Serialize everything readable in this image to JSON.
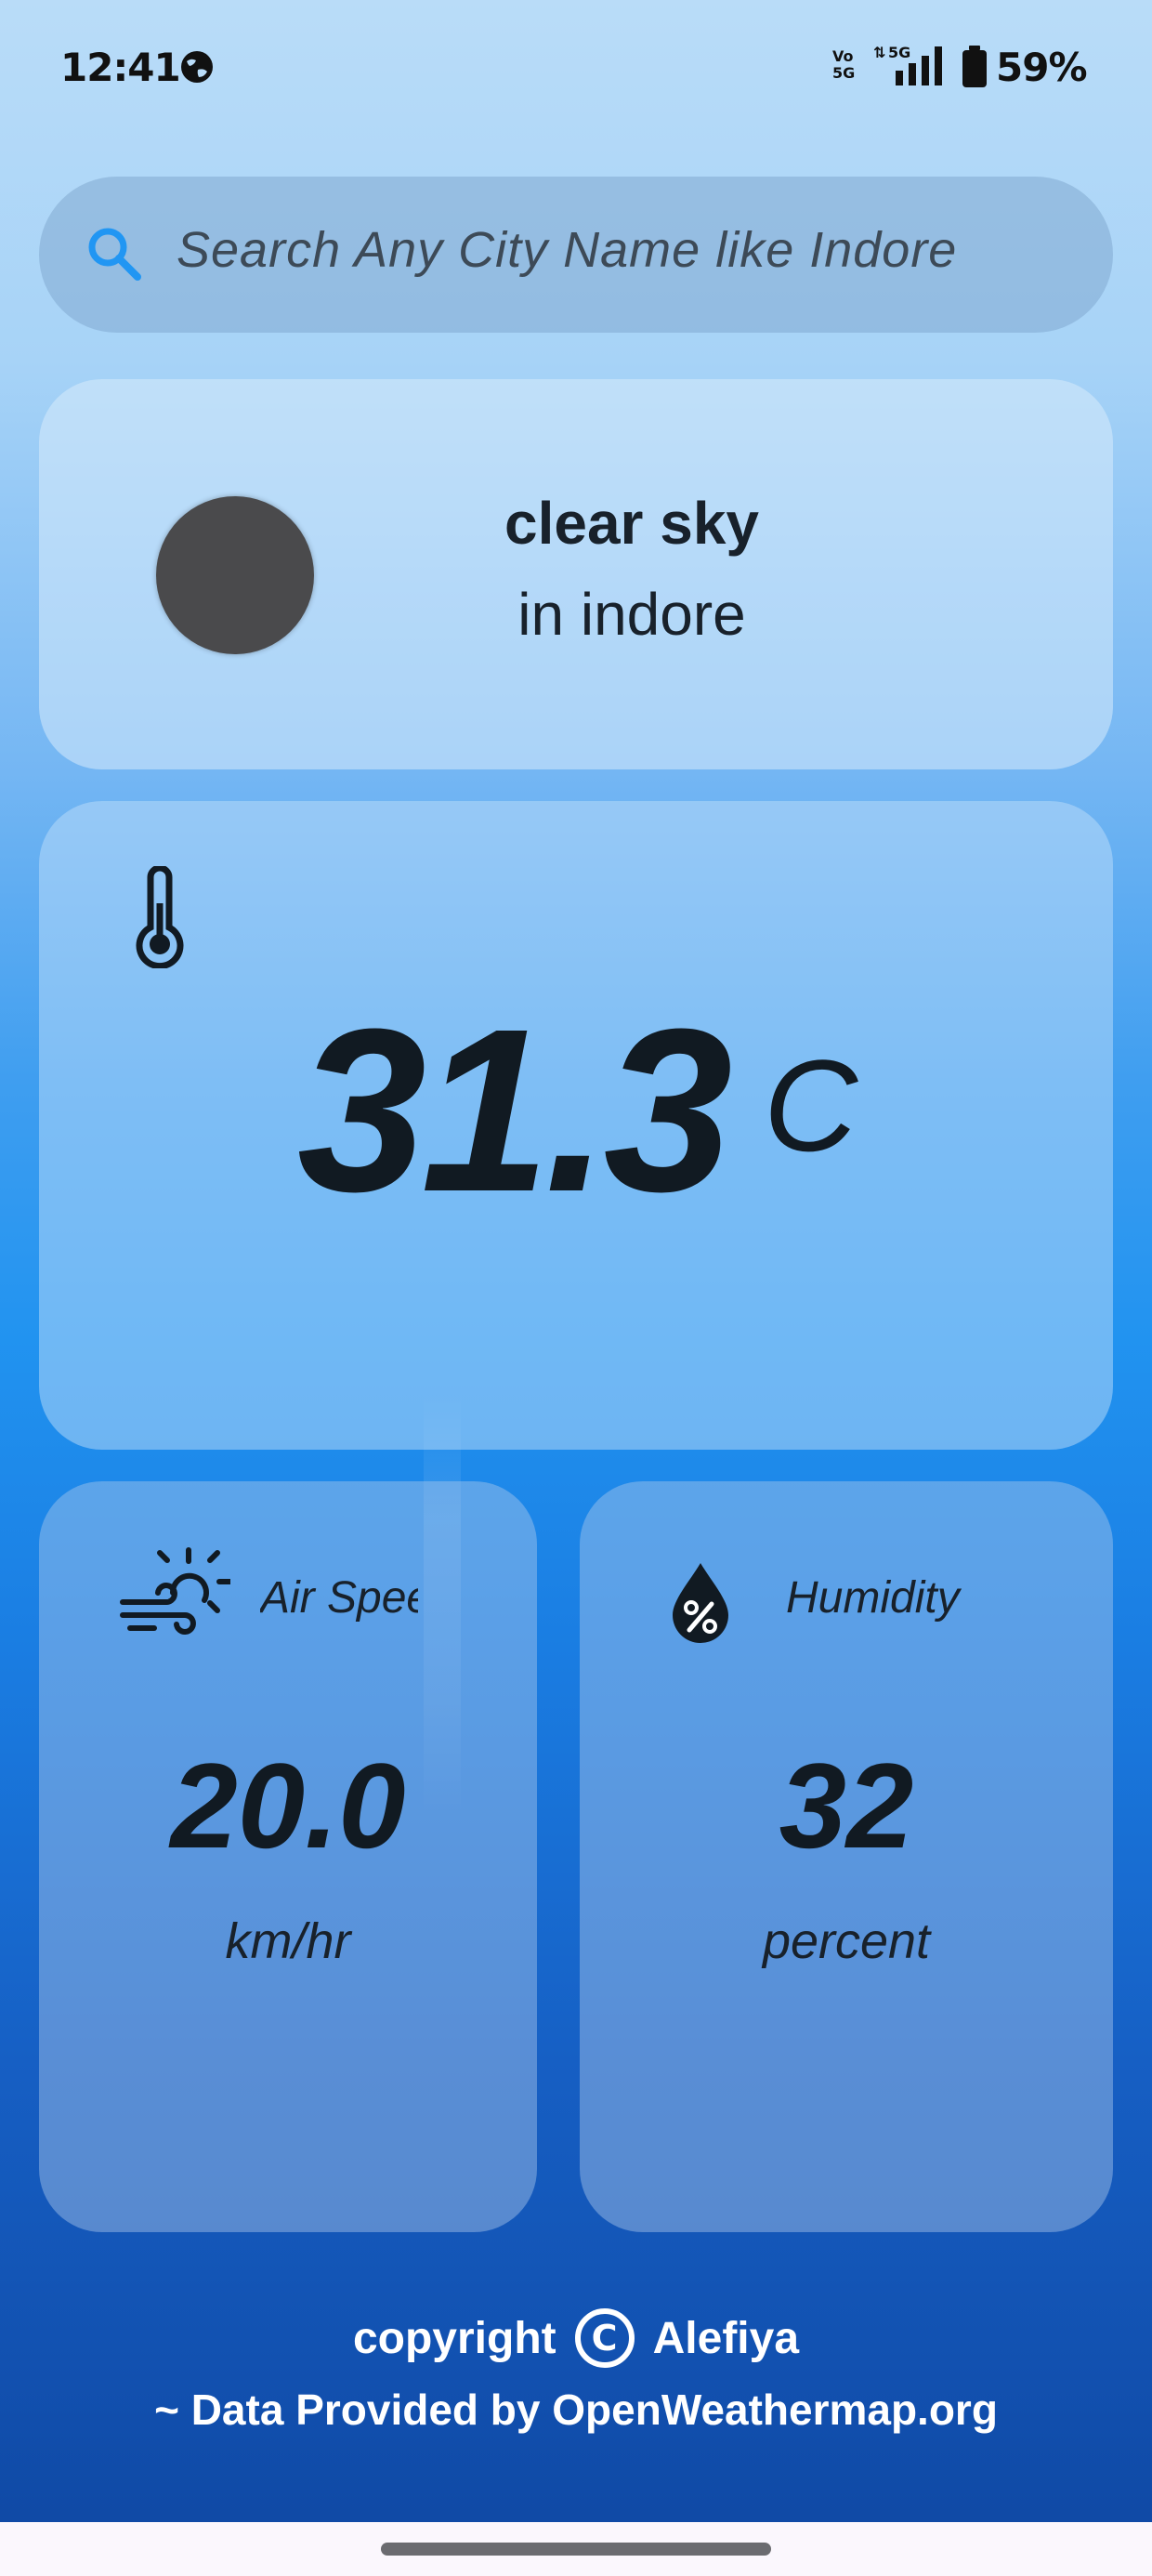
{
  "status_bar": {
    "time": "12:41",
    "network_label_top": "Vo",
    "network_label_bottom": "5G",
    "data_label": "5G",
    "battery_text": "59%"
  },
  "search": {
    "placeholder": "Search Any City Name like Indore"
  },
  "condition": {
    "description": "clear sky",
    "location": "in indore"
  },
  "temperature": {
    "value": "31.3",
    "unit": "C"
  },
  "air_speed": {
    "label": "Air Speed",
    "value": "20.0",
    "unit": "km/hr"
  },
  "humidity": {
    "label": "Humidity",
    "value": "32",
    "unit": "percent"
  },
  "footer": {
    "copyright_text": "copyright",
    "copyright_symbol": "C",
    "author": "Alefiya",
    "credit": "~ Data Provided by OpenWeathermap.org"
  },
  "colors": {
    "accent": "#2196f3",
    "text_dark": "#111a22"
  },
  "icons": {
    "search": "search-icon",
    "thermometer": "thermometer-icon",
    "air": "wind-sun-icon",
    "humidity": "humidity-drop-icon",
    "weather": "weather-icon"
  }
}
